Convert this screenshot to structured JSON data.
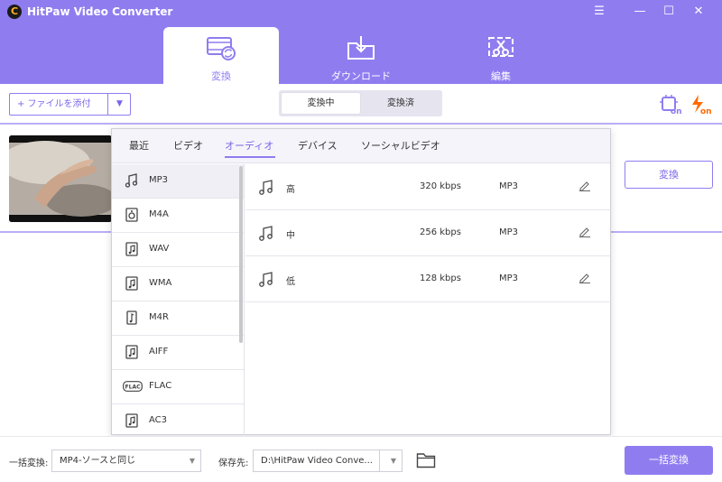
{
  "app": {
    "logo_letter": "C",
    "title": "HitPaw Video Converter"
  },
  "window_controls": {
    "menu": "☰",
    "minimize": "—",
    "maximize": "☐",
    "close": "✕"
  },
  "tabs": [
    {
      "label": "変換",
      "icon": "convert-film-icon",
      "active": true
    },
    {
      "label": "ダウンロード",
      "icon": "download-folder-icon",
      "active": false
    },
    {
      "label": "編集",
      "icon": "edit-scissors-icon",
      "active": false
    }
  ],
  "toolbar": {
    "add_file_label": "+ ファイルを添付",
    "add_file_dropdown": "▼",
    "segment": [
      {
        "label": "変換中",
        "active": true
      },
      {
        "label": "変換済",
        "active": false
      }
    ],
    "right_icons": [
      "hardware-acceleration-on-icon",
      "lightning-speed-on-icon"
    ],
    "on_text": "on"
  },
  "video": {
    "convert_label": "変換"
  },
  "format_popup": {
    "categories": [
      {
        "label": "最近",
        "active": false
      },
      {
        "label": "ビデオ",
        "active": false
      },
      {
        "label": "オーディオ",
        "active": true
      },
      {
        "label": "デバイス",
        "active": false
      },
      {
        "label": "ソーシャルビデオ",
        "active": false
      }
    ],
    "formats": [
      {
        "label": "MP3",
        "icon": "music-note-file-icon",
        "selected": true
      },
      {
        "label": "M4A",
        "icon": "speaker-file-icon",
        "selected": false
      },
      {
        "label": "WAV",
        "icon": "music-note-file-icon",
        "selected": false
      },
      {
        "label": "WMA",
        "icon": "music-note-file-icon",
        "selected": false
      },
      {
        "label": "M4R",
        "icon": "music-note-file-icon",
        "selected": false
      },
      {
        "label": "AIFF",
        "icon": "music-note-file-icon",
        "selected": false
      },
      {
        "label": "FLAC",
        "icon": "flac-badge-icon",
        "selected": false,
        "badge": "FLAC"
      },
      {
        "label": "AC3",
        "icon": "music-note-file-icon",
        "selected": false
      }
    ],
    "presets": [
      {
        "name": "高",
        "bitrate": "320 kbps",
        "format": "MP3"
      },
      {
        "name": "中",
        "bitrate": "256 kbps",
        "format": "MP3"
      },
      {
        "name": "低",
        "bitrate": "128 kbps",
        "format": "MP3"
      }
    ]
  },
  "bottom": {
    "batch_convert_label": "一括変換:",
    "batch_convert_value": "MP4-ソースと同じ",
    "save_to_label": "保存先:",
    "save_to_value": "D:\\HitPaw Video Conve...",
    "dropdown_arrow": "▼",
    "batch_button": "一括変換"
  },
  "colors": {
    "accent": "#8f7df0",
    "accent_text": "#7a66e8",
    "on_badge": "#ff6a00"
  }
}
